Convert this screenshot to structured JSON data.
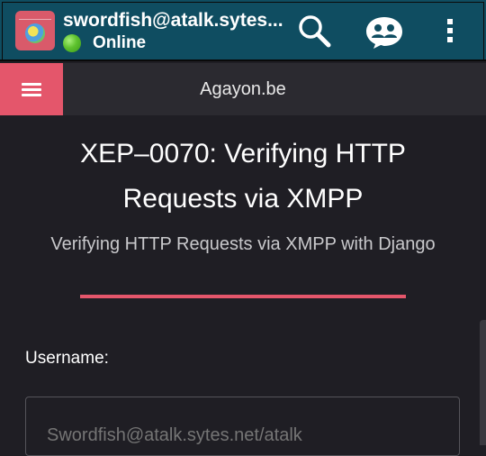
{
  "appbar": {
    "title": "swordfish@atalk.sytes...",
    "status": "Online",
    "icons": [
      "avatar",
      "online-status-icon",
      "search-icon",
      "contacts-icon",
      "more-vert-icon"
    ],
    "bg_color": "#0f4d61"
  },
  "navbar": {
    "site_title": "Agayon.be",
    "menu_icon": "hamburger-icon",
    "accent_color": "#e4566b"
  },
  "main": {
    "heading": "XEP–0070: Verifying HTTP Requests via XMPP",
    "subheading": "Verifying HTTP Requests via XMPP with Django",
    "username_label": "Username:",
    "username_placeholder": "Swordfish@atalk.sytes.net/atalk"
  }
}
